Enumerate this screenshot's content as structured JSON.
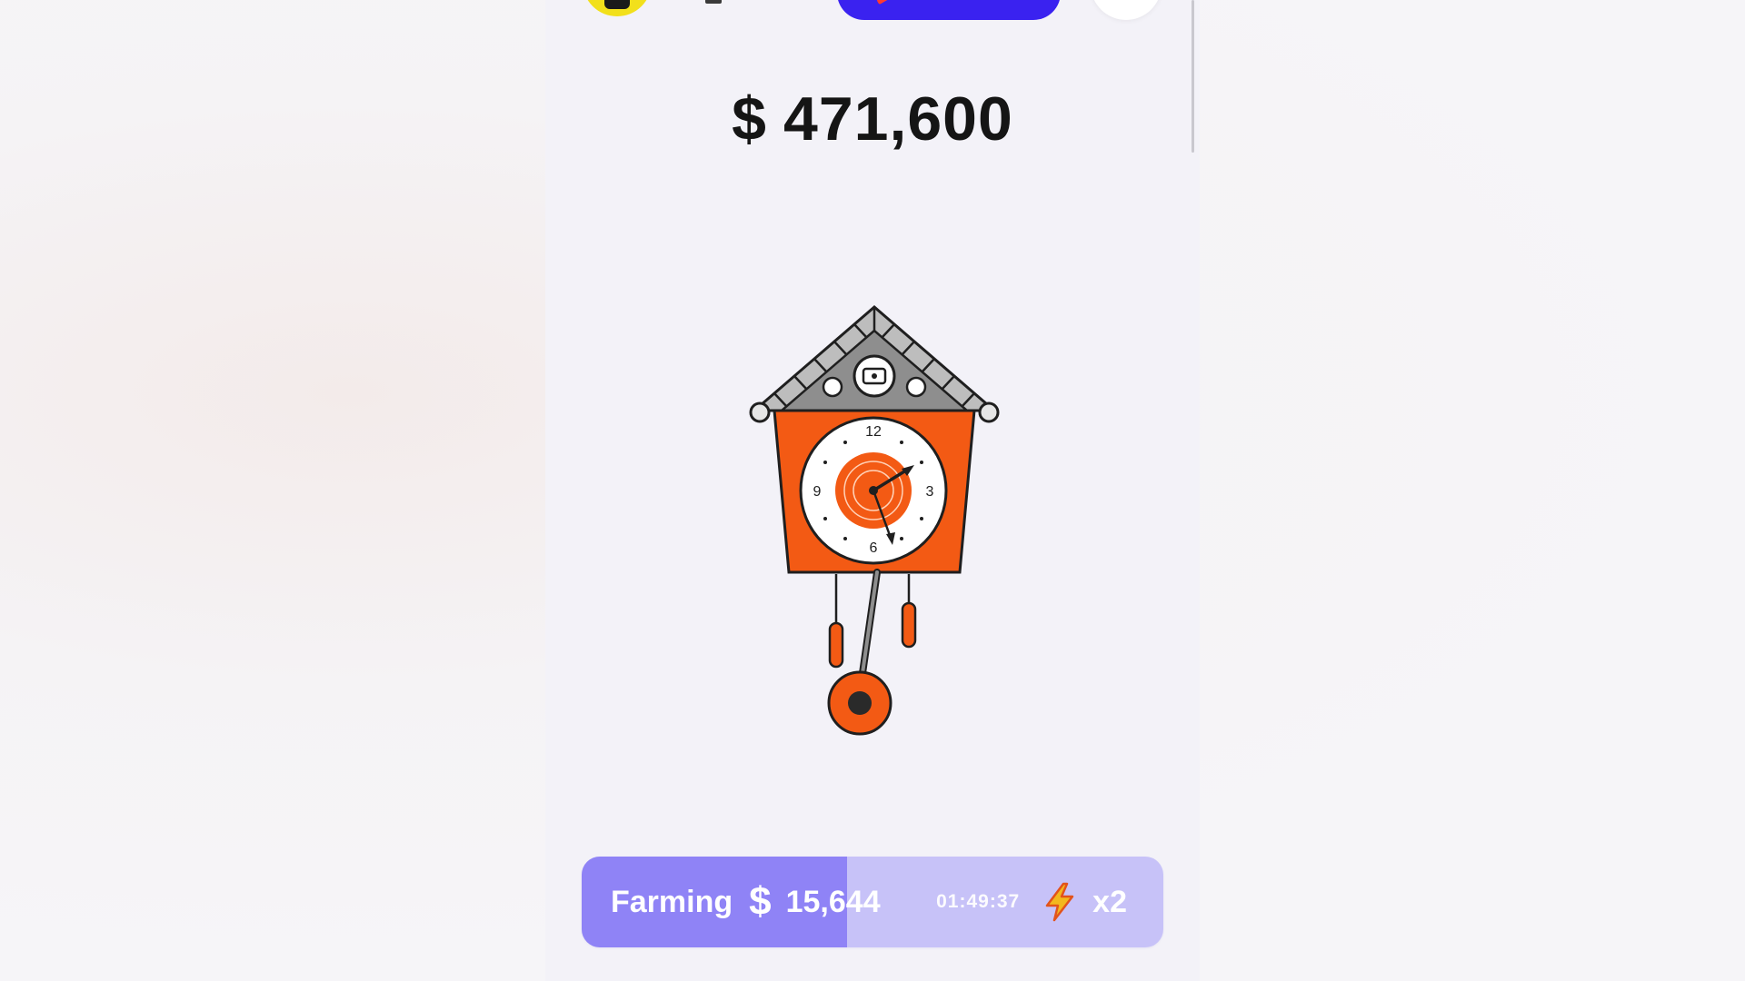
{
  "balance": {
    "currency_symbol": "$",
    "amount": "471,600"
  },
  "clock": {
    "numerals": {
      "twelve": "12",
      "three": "3",
      "six": "6",
      "nine": "9"
    },
    "icon": "cuckoo-clock-icon"
  },
  "farming": {
    "label": "Farming",
    "currency_symbol": "$",
    "amount": "15,644",
    "timer": "01:49:37",
    "boost_icon": "lightning-icon",
    "multiplier": "x2",
    "progress": 0.456
  },
  "colors": {
    "accent": "#3a22f0",
    "clock_orange": "#f35a14",
    "farming_fill": "#8f83f6",
    "farming_track": "#c7c2f8",
    "bolt": "#f2b81f"
  }
}
